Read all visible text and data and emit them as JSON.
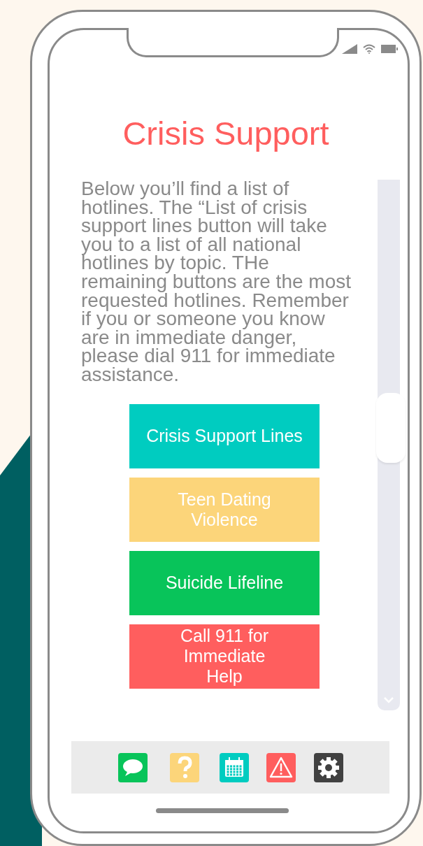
{
  "screen": {
    "title": "Crisis Support",
    "intro": "Below you’ll find a list of hotlines. The “List of crisis support lines button will take you to a list of all national hotlines by topic. THe remaining buttons are the most requested hotlines. Remember if you or someone you know are in immediate danger, please dial 911 for immediate assistance.",
    "buttons": [
      {
        "label": "Crisis Support Lines",
        "color": "#00ccc0"
      },
      {
        "label": "Teen Dating Violence",
        "color": "#fcd57a"
      },
      {
        "label": "Suicide Lifeline",
        "color": "#08c45a"
      },
      {
        "label": "Call 911 for Immediate Help",
        "color": "#ff5e5e"
      }
    ]
  },
  "tab_bar": [
    {
      "kind": "chat"
    },
    {
      "kind": "help"
    },
    {
      "kind": "calendar"
    },
    {
      "kind": "alert"
    },
    {
      "kind": "settings"
    }
  ]
}
